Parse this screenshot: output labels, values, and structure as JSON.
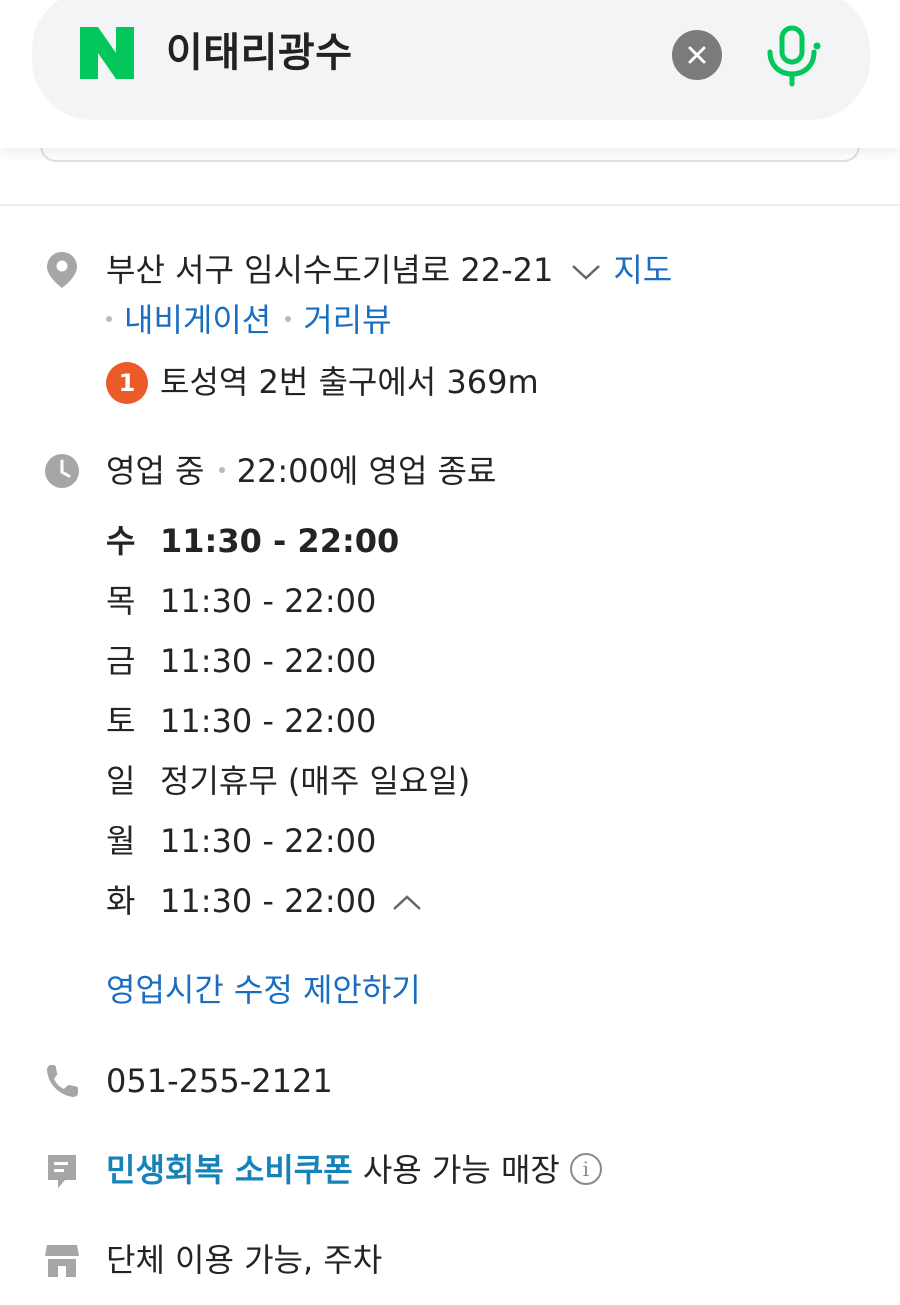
{
  "search": {
    "query": "이태리광수",
    "logo_letter": "N",
    "icons": [
      "naver-logo",
      "clear-icon",
      "mic-icon"
    ],
    "brand_color": "#03c75a"
  },
  "address": {
    "text": "부산 서구 임시수도기념로 22-21",
    "map_link": "지도",
    "navigation_link": "내비게이션",
    "street_view_link": "거리뷰",
    "station_number": "1",
    "station_text": "토성역 2번 출구에서 369m"
  },
  "business": {
    "status": "영업 중",
    "status_detail": "22:00에 영업 종료",
    "hours": [
      {
        "day": "수",
        "time": "11:30 - 22:00",
        "current": true
      },
      {
        "day": "목",
        "time": "11:30 - 22:00"
      },
      {
        "day": "금",
        "time": "11:30 - 22:00"
      },
      {
        "day": "토",
        "time": "11:30 - 22:00"
      },
      {
        "day": "일",
        "time": "정기휴무 (매주 일요일)"
      },
      {
        "day": "월",
        "time": "11:30 - 22:00"
      },
      {
        "day": "화",
        "time": "11:30 - 22:00"
      }
    ],
    "suggest_edit_link": "영업시간 수정 제안하기"
  },
  "phone": {
    "number": "051-255-2121"
  },
  "coupon": {
    "link": "민생회복 소비쿠폰",
    "text": "사용 가능 매장",
    "info_glyph": "i"
  },
  "facilities": {
    "text": "단체 이용 가능, 주차"
  },
  "colors": {
    "link": "#1a6ec2",
    "coupon_link": "#1583b9",
    "station_badge": "#ea5b29",
    "icon_gray": "#a6a6a6"
  }
}
